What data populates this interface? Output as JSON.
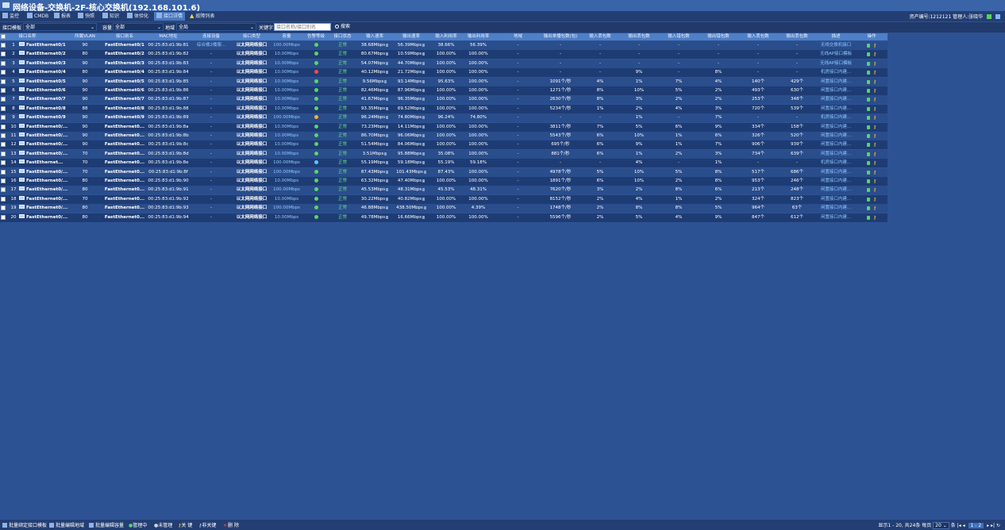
{
  "window": {
    "title": "网络设备-交换机-2F-核心交换机(192.168.101.6)"
  },
  "tabs": [
    {
      "label": "监控",
      "active": false
    },
    {
      "label": "CMDB",
      "active": false
    },
    {
      "label": "报表",
      "active": false
    },
    {
      "label": "快照",
      "active": false
    },
    {
      "label": "知识",
      "active": false
    },
    {
      "label": "体验化",
      "active": false
    },
    {
      "label": "接口详情",
      "active": true
    },
    {
      "label": "故障列表",
      "active": false
    }
  ],
  "header_right": {
    "asset": "资产编号:1212121",
    "admin": "管理人:张晓华"
  },
  "filters": {
    "template_label": "接口模板",
    "template_value": "全部",
    "capacity_label": "容量",
    "capacity_value": "全部",
    "location_label": "地域",
    "location_value": "全局",
    "keyword_label": "关键字",
    "keyword_placeholder": "接口名称/接口别名",
    "search_label": "搜索"
  },
  "columns": [
    "",
    "接口名称",
    "所属VLAN",
    "接口别名",
    "MAC地址",
    "连接设备",
    "接口类型",
    "容量",
    "告警等级",
    "接口状态",
    "输入速率",
    "输出速率",
    "输入利用率",
    "输出利用率",
    "地域",
    "输出单播包数(包)",
    "输入丢包数",
    "输出丢包数",
    "输入错包数",
    "输出错包数",
    "输入丢包数",
    "输出丢包数",
    "描述",
    "操作"
  ],
  "rows": [
    {
      "no": "1",
      "name": "FastEthernet0/1",
      "vlan": "90",
      "alias": "FastEthernet0/1",
      "mac": "00:25:83:d1:9b:81",
      "device": "综合楼2楼服...",
      "type": "以太网网络接口",
      "cap": "100.00Mbps",
      "alarm": "green",
      "status": "正常",
      "in_rate": "38.68Mbps",
      "out_rate": "56.39Mbps",
      "in_util": "38.66%",
      "out_util": "56.39%",
      "region": "-",
      "c1": "-",
      "c2": "-",
      "c3": "-",
      "c4": "-",
      "c5": "-",
      "c6": "-",
      "c7": "-",
      "desc": "无线交换机接口"
    },
    {
      "no": "2",
      "name": "FastEthernet0/2",
      "vlan": "80",
      "alias": "FastEthernet0/2",
      "mac": "00:25:83:d1:9b:82",
      "device": "-",
      "type": "以太网网络接口",
      "cap": "10.00Mbps",
      "alarm": "green",
      "status": "正常",
      "in_rate": "80.67Mbps",
      "out_rate": "10.59Mbps",
      "in_util": "100.00%",
      "out_util": "100.00%",
      "region": "-",
      "c1": "-",
      "c2": "-",
      "c3": "-",
      "c4": "-",
      "c5": "-",
      "c6": "-",
      "c7": "-",
      "desc": "无线AP接口模板"
    },
    {
      "no": "3",
      "name": "FastEthernet0/3",
      "vlan": "90",
      "alias": "FastEthernet0/3",
      "mac": "00:25:83:d1:9b:83",
      "device": "-",
      "type": "以太网网络接口",
      "cap": "10.00Mbps",
      "alarm": "green",
      "status": "正常",
      "in_rate": "54.07Mbps",
      "out_rate": "44.70Mbps",
      "in_util": "100.00%",
      "out_util": "100.00%",
      "region": "-",
      "c1": "-",
      "c2": "-",
      "c3": "-",
      "c4": "-",
      "c5": "-",
      "c6": "-",
      "c7": "-",
      "desc": "无线AP接口模板"
    },
    {
      "no": "4",
      "name": "FastEthernet0/4",
      "vlan": "80",
      "alias": "FastEthernet0/4",
      "mac": "00:25:83:d1:9b:84",
      "device": "-",
      "type": "以太网网络接口",
      "cap": "10.00Mbps",
      "alarm": "red",
      "status": "正常",
      "in_rate": "40.12Mbps",
      "out_rate": "21.72Mbps",
      "in_util": "100.00%",
      "out_util": "100.00%",
      "region": "-",
      "c1": "-",
      "c2": "-",
      "c3": "9%",
      "c4": "-",
      "c5": "8%",
      "c6": "-",
      "c7": "-",
      "desc": "机房接口内建..."
    },
    {
      "no": "5",
      "name": "FastEthernet0/5",
      "vlan": "90",
      "alias": "FastEthernet0/5",
      "mac": "00:25:83:d1:9b:85",
      "device": "-",
      "type": "以太网网络接口",
      "cap": "10.00Mbps",
      "alarm": "green",
      "status": "正常",
      "in_rate": "9.56Mbps",
      "out_rate": "93.14Mbps",
      "in_util": "95.63%",
      "out_util": "100.00%",
      "region": "-",
      "c1": "1091个/秒",
      "c2": "4%",
      "c3": "1%",
      "c4": "7%",
      "c5": "4%",
      "c6": "140个",
      "c7": "429个",
      "desc": "闲置接口内建..."
    },
    {
      "no": "6",
      "name": "FastEthernet0/6",
      "vlan": "90",
      "alias": "FastEthernet0/6",
      "mac": "00:25:83:d1:9b:86",
      "device": "-",
      "type": "以太网网络接口",
      "cap": "10.00Mbps",
      "alarm": "green",
      "status": "正常",
      "in_rate": "82.46Mbps",
      "out_rate": "87.96Mbps",
      "in_util": "100.00%",
      "out_util": "100.00%",
      "region": "-",
      "c1": "1271个/秒",
      "c2": "8%",
      "c3": "10%",
      "c4": "5%",
      "c5": "2%",
      "c6": "493个",
      "c7": "630个",
      "desc": "闲置接口内建..."
    },
    {
      "no": "7",
      "name": "FastEthernet0/7",
      "vlan": "90",
      "alias": "FastEthernet0/7",
      "mac": "00:25:83:d1:9b:87",
      "device": "-",
      "type": "以太网网络接口",
      "cap": "10.00Mbps",
      "alarm": "green",
      "status": "正常",
      "in_rate": "41.67Mbps",
      "out_rate": "96.35Mbps",
      "in_util": "100.00%",
      "out_util": "100.00%",
      "region": "-",
      "c1": "2630个/秒",
      "c2": "8%",
      "c3": "3%",
      "c4": "2%",
      "c5": "2%",
      "c6": "253个",
      "c7": "348个",
      "desc": "闲置接口内建..."
    },
    {
      "no": "8",
      "name": "FastEthernet0/8",
      "vlan": "88",
      "alias": "FastEthernet0/8",
      "mac": "00:25:83:d1:9b:88",
      "device": "-",
      "type": "以太网网络接口",
      "cap": "10.00Mbps",
      "alarm": "green",
      "status": "正常",
      "in_rate": "93.35Mbps",
      "out_rate": "69.52Mbps",
      "in_util": "100.00%",
      "out_util": "100.00%",
      "region": "-",
      "c1": "5234个/秒",
      "c2": "1%",
      "c3": "2%",
      "c4": "4%",
      "c5": "3%",
      "c6": "720个",
      "c7": "539个",
      "desc": "闲置接口内建..."
    },
    {
      "no": "9",
      "name": "FastEthernet0/9",
      "vlan": "90",
      "alias": "FastEthernet0/9",
      "mac": "00:25:83:d1:9b:89",
      "device": "-",
      "type": "以太网网络接口",
      "cap": "100.00Mbps",
      "alarm": "orange",
      "status": "正常",
      "in_rate": "96.24Mbps",
      "out_rate": "74.80Mbps",
      "in_util": "96.24%",
      "out_util": "74.80%",
      "region": "-",
      "c1": "-",
      "c2": "-",
      "c3": "1%",
      "c4": "-",
      "c5": "7%",
      "c6": "-",
      "c7": "-",
      "desc": "机房接口内建..."
    },
    {
      "no": "10",
      "name": "FastEthernet0/...",
      "vlan": "90",
      "alias": "FastEthernet0...",
      "mac": "00:25:83:d1:9b:8a",
      "device": "-",
      "type": "以太网网络接口",
      "cap": "10.00Mbps",
      "alarm": "green",
      "status": "正常",
      "in_rate": "73.23Mbps",
      "out_rate": "14.11Mbps",
      "in_util": "100.00%",
      "out_util": "100.00%",
      "region": "-",
      "c1": "3811个/秒",
      "c2": "7%",
      "c3": "5%",
      "c4": "6%",
      "c5": "9%",
      "c6": "334个",
      "c7": "158个",
      "desc": "闲置接口内建..."
    },
    {
      "no": "11",
      "name": "FastEthernet0/...",
      "vlan": "90",
      "alias": "FastEthernet0...",
      "mac": "00:25:83:d1:9b:8b",
      "device": "-",
      "type": "以太网网络接口",
      "cap": "10.00Mbps",
      "alarm": "green",
      "status": "正常",
      "in_rate": "86.70Mbps",
      "out_rate": "96.06Mbps",
      "in_util": "100.00%",
      "out_util": "100.00%",
      "region": "-",
      "c1": "5543个/秒",
      "c2": "6%",
      "c3": "10%",
      "c4": "1%",
      "c5": "6%",
      "c6": "326个",
      "c7": "520个",
      "desc": "闲置接口内建..."
    },
    {
      "no": "12",
      "name": "FastEthernet0/...",
      "vlan": "90",
      "alias": "FastEthernet0...",
      "mac": "00:25:83:d1:9b:8c",
      "device": "-",
      "type": "以太网网络接口",
      "cap": "10.00Mbps",
      "alarm": "green",
      "status": "正常",
      "in_rate": "51.54Mbps",
      "out_rate": "84.06Mbps",
      "in_util": "100.00%",
      "out_util": "100.00%",
      "region": "-",
      "c1": "695个/秒",
      "c2": "6%",
      "c3": "9%",
      "c4": "1%",
      "c5": "7%",
      "c6": "906个",
      "c7": "939个",
      "desc": "闲置接口内建..."
    },
    {
      "no": "13",
      "name": "FastEthernet0/...",
      "vlan": "70",
      "alias": "FastEthernet0...",
      "mac": "00:25:83:d1:9b:8d",
      "device": "-",
      "type": "以太网网络接口",
      "cap": "10.00Mbps",
      "alarm": "green",
      "status": "正常",
      "in_rate": "3.51Mbps",
      "out_rate": "95.88Mbps",
      "in_util": "35.08%",
      "out_util": "100.00%",
      "region": "-",
      "c1": "881个/秒",
      "c2": "6%",
      "c3": "1%",
      "c4": "2%",
      "c5": "3%",
      "c6": "734个",
      "c7": "639个",
      "desc": "闲置接口内建..."
    },
    {
      "no": "14",
      "name": "FastEthernet...",
      "vlan": "70",
      "alias": "FastEthernet0...",
      "mac": "00:25:83:d1:9b:8e",
      "device": "-",
      "type": "以太网网络接口",
      "cap": "100.00Mbps",
      "alarm": "blue",
      "status": "正常",
      "in_rate": "55.19Mbps",
      "out_rate": "59.18Mbps",
      "in_util": "55.19%",
      "out_util": "59.18%",
      "region": "-",
      "c1": "-",
      "c2": "-",
      "c3": "4%",
      "c4": "-",
      "c5": "1%",
      "c6": "-",
      "c7": "-",
      "desc": "机房接口内建..."
    },
    {
      "no": "15",
      "name": "FastEthernet0/...",
      "vlan": "70",
      "alias": "FastEthernet0...",
      "mac": "00:25:83:d1:9b:8f",
      "device": "-",
      "type": "以太网网络接口",
      "cap": "100.00Mbps",
      "alarm": "green",
      "status": "正常",
      "in_rate": "87.43Mbps",
      "out_rate": "101.43Mbps",
      "in_util": "87.43%",
      "out_util": "100.00%",
      "region": "-",
      "c1": "4978个/秒",
      "c2": "5%",
      "c3": "10%",
      "c4": "5%",
      "c5": "8%",
      "c6": "517个",
      "c7": "686个",
      "desc": "闲置接口内建..."
    },
    {
      "no": "16",
      "name": "FastEthernet0/...",
      "vlan": "80",
      "alias": "FastEthernet0...",
      "mac": "00:25:83:d1:9b:90",
      "device": "-",
      "type": "以太网网络接口",
      "cap": "10.00Mbps",
      "alarm": "green",
      "status": "正常",
      "in_rate": "63.32Mbps",
      "out_rate": "47.40Mbps",
      "in_util": "100.00%",
      "out_util": "100.00%",
      "region": "-",
      "c1": "1891个/秒",
      "c2": "6%",
      "c3": "10%",
      "c4": "2%",
      "c5": "8%",
      "c6": "953个",
      "c7": "246个",
      "desc": "闲置接口内建..."
    },
    {
      "no": "17",
      "name": "FastEthernet0/...",
      "vlan": "80",
      "alias": "FastEthernet0...",
      "mac": "00:25:83:d1:9b:91",
      "device": "-",
      "type": "以太网网络接口",
      "cap": "100.00Mbps",
      "alarm": "green",
      "status": "正常",
      "in_rate": "45.53Mbps",
      "out_rate": "48.31Mbps",
      "in_util": "45.53%",
      "out_util": "48.31%",
      "region": "-",
      "c1": "7620个/秒",
      "c2": "3%",
      "c3": "2%",
      "c4": "8%",
      "c5": "6%",
      "c6": "213个",
      "c7": "248个",
      "desc": "闲置接口内建..."
    },
    {
      "no": "18",
      "name": "FastEthernet0/...",
      "vlan": "70",
      "alias": "FastEthernet0...",
      "mac": "00:25:83:d1:9b:92",
      "device": "-",
      "type": "以太网网络接口",
      "cap": "10.00Mbps",
      "alarm": "green",
      "status": "正常",
      "in_rate": "30.22Mbps",
      "out_rate": "40.82Mbps",
      "in_util": "100.00%",
      "out_util": "100.00%",
      "region": "-",
      "c1": "8152个/秒",
      "c2": "2%",
      "c3": "4%",
      "c4": "1%",
      "c5": "2%",
      "c6": "324个",
      "c7": "823个",
      "desc": "闲置接口内建..."
    },
    {
      "no": "19",
      "name": "FastEthernet0/...",
      "vlan": "80",
      "alias": "FastEthernet0...",
      "mac": "00:25:83:d1:9b:93",
      "device": "-",
      "type": "以太网网络接口",
      "cap": "100.00Mbps",
      "alarm": "green",
      "status": "正常",
      "in_rate": "46.88Mbps",
      "out_rate": "438.50Mbps",
      "in_util": "100.00%",
      "out_util": "4.39%",
      "region": "-",
      "c1": "1748个/秒",
      "c2": "2%",
      "c3": "8%",
      "c4": "8%",
      "c5": "5%",
      "c6": "964个",
      "c7": "63个",
      "desc": "闲置接口内建..."
    },
    {
      "no": "20",
      "name": "FastEthernet0/...",
      "vlan": "80",
      "alias": "FastEthernet0...",
      "mac": "00:25:83:d1:9b:94",
      "device": "-",
      "type": "以太网网络接口",
      "cap": "10.00Mbps",
      "alarm": "green",
      "status": "正常",
      "in_rate": "49.78Mbps",
      "out_rate": "16.66Mbps",
      "in_util": "100.00%",
      "out_util": "100.00%",
      "region": "-",
      "c1": "5596个/秒",
      "c2": "2%",
      "c3": "5%",
      "c4": "4%",
      "c5": "9%",
      "c6": "847个",
      "c7": "612个",
      "desc": "闲置接口内建..."
    }
  ],
  "bottom_actions": [
    "批量绑定接口模板",
    "批量编辑地域",
    "批量编辑容量",
    "管理中",
    "未管理",
    "关 键",
    "非关键",
    "删 除"
  ],
  "pager": {
    "summary": "显示1 - 20, 共24条",
    "per_page_label": "每页",
    "per_page": "20",
    "unit": "条",
    "pages": "1 - 2"
  },
  "alarm_colors": {
    "green": "#5bd46a",
    "red": "#ff4a4a",
    "orange": "#ffb12e",
    "blue": "#5ec2ff"
  }
}
